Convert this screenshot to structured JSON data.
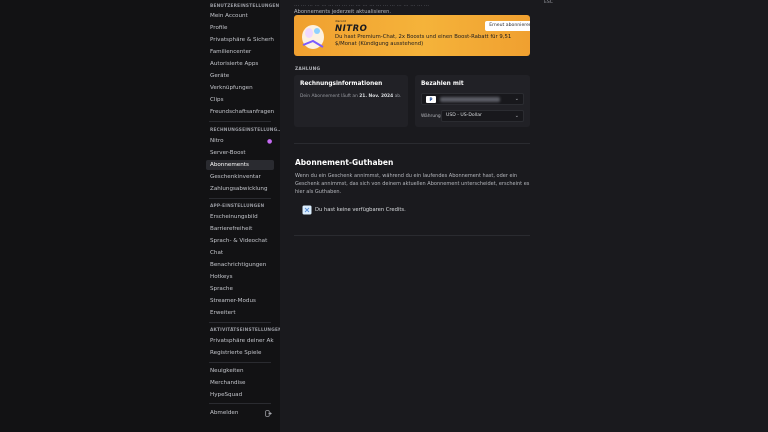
{
  "sidebar": {
    "sections": [
      {
        "heading": "BENUTZEREINSTELLUNGEN",
        "items": [
          "Mein Account",
          "Profile",
          "Privatsphäre & Sicherh…",
          "Familiencenter",
          "Autorisierte Apps",
          "Geräte",
          "Verknüpfungen",
          "Clips",
          "Freundschaftsanfragen"
        ]
      },
      {
        "heading": "RECHNUNGSEINSTELLUNG…",
        "items": [
          "Nitro",
          "Server-Boost",
          "Abonnements",
          "Geschenkinventar",
          "Zahlungsabwicklung"
        ]
      },
      {
        "heading": "APP-EINSTELLUNGEN",
        "items": [
          "Erscheinungsbild",
          "Barrierefreiheit",
          "Sprach- & Videochat",
          "Chat",
          "Benachrichtigungen",
          "Hotkeys",
          "Sprache",
          "Streamer-Modus",
          "Erweitert"
        ]
      },
      {
        "heading": "AKTIVITÄTSEINSTELLUNGEN",
        "items": [
          "Privatsphäre deiner Ak…",
          "Registrierte Spiele"
        ]
      },
      {
        "heading": "",
        "items": [
          "Neuigkeiten",
          "Merchandise",
          "HypeSquad"
        ]
      }
    ],
    "logout": "Abmelden",
    "active_item": "Abonnements",
    "nitro_badge_color": "#c56af2"
  },
  "main": {
    "top_text_line1": "… … … … … … … … … … … … … … … … … … … …",
    "top_text_line2": "Abonnements jederzeit aktualisieren.",
    "esc_label": "ESC",
    "nitro": {
      "sub_logo": "discord",
      "logo": "NITRO",
      "text": "Du hast Premium-Chat, 2x Boosts und einen Boost-Rabatt für 9,51 $/Monat (Kündigung ausstehend)",
      "button": "Erneut abonnieren"
    },
    "payment_section": "ZAHLUNG",
    "billing": {
      "title": "Rechnungsinformationen",
      "text_prefix": "Dein Abonnement läuft an ",
      "date": "21. Nov. 2024",
      "text_suffix": " ab."
    },
    "pay_with": {
      "title": "Bezahlen mit",
      "card_brand": "P",
      "currency_label": "Währung",
      "currency_value": "USD - US-Dollar"
    },
    "credits": {
      "heading": "Abonnement-Guthaben",
      "description": "Wenn du ein Geschenk annimmst, während du ein laufendes Abonnement hast, oder ein Geschenk annimmst, das sich von deinem aktuellen Abonnement unterscheidet, erscheint es hier als Guthaben.",
      "empty": "Du hast keine verfügbaren Credits."
    }
  },
  "colors": {
    "accent_banner": "#f5b33a",
    "background": "#1a1a1e",
    "sidebar": "#121214"
  }
}
